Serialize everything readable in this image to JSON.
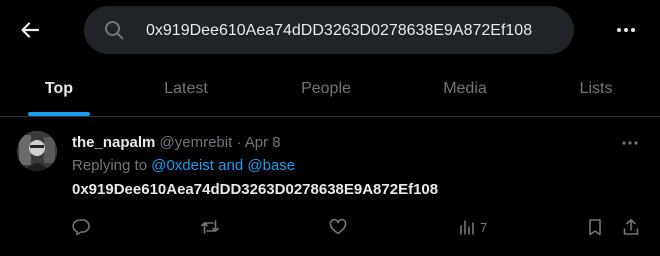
{
  "topbar": {
    "back_icon": "arrow-left-icon",
    "search": {
      "value": "0x919Dee610Aea74dDD3263D0278638E9A872Ef108",
      "icon": "search-icon"
    },
    "more_icon": "more-dots-icon"
  },
  "tabs": [
    {
      "label": "Top",
      "active": true
    },
    {
      "label": "Latest",
      "active": false
    },
    {
      "label": "People",
      "active": false
    },
    {
      "label": "Media",
      "active": false
    },
    {
      "label": "Lists",
      "active": false
    }
  ],
  "tweet": {
    "display_name": "the_napalm",
    "handle": "@yemrebit",
    "separator": " · ",
    "date": "Apr 8",
    "replying_to_prefix": "Replying to ",
    "mention_1": "@0xdeist",
    "mention_joiner": " and ",
    "mention_2": "@base",
    "text": "0x919Dee610Aea74dDD3263D0278638E9A872Ef108",
    "actions": {
      "reply_count": "",
      "retweet_count": "",
      "like_count": "",
      "views_count": "7"
    }
  },
  "colors": {
    "background": "#000000",
    "text": "#e7e9ea",
    "muted": "#71767b",
    "accent": "#1d9bf0",
    "search_bg": "#202327",
    "divider": "#2f3336"
  }
}
